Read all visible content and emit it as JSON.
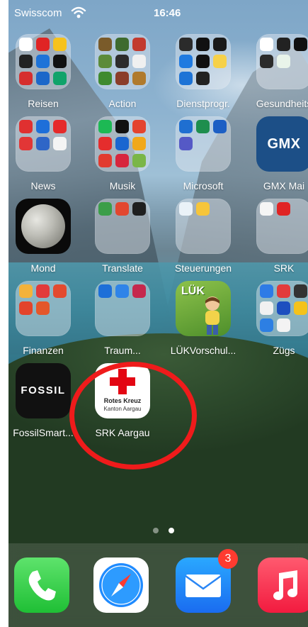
{
  "status_bar": {
    "carrier": "Swisscom",
    "time": "16:46"
  },
  "apps": [
    {
      "label": "Reisen"
    },
    {
      "label": "Action"
    },
    {
      "label": "Dienstprogr."
    },
    {
      "label": "Gesundheits"
    },
    {
      "label": "News"
    },
    {
      "label": "Musik"
    },
    {
      "label": "Microsoft"
    },
    {
      "label": "GMX Mai",
      "tile_text": "GMX"
    },
    {
      "label": "Mond"
    },
    {
      "label": "Translate"
    },
    {
      "label": "Steuerungen"
    },
    {
      "label": "SRK"
    },
    {
      "label": "Finanzen"
    },
    {
      "label": "Traum..."
    },
    {
      "label": "LÜKVorschul...",
      "tile_text": "LÜK"
    },
    {
      "label": "Zügs"
    },
    {
      "label": "FossilSmart...",
      "tile_text": "FOSSIL"
    },
    {
      "label": "SRK Aargau",
      "tile_line1": "Rotes Kreuz",
      "tile_line2": "Kanton Aargau"
    }
  ],
  "dock": {
    "apps": [
      {
        "name": "Phone"
      },
      {
        "name": "Safari"
      },
      {
        "name": "Mail",
        "badge": "3"
      },
      {
        "name": "Music"
      }
    ]
  },
  "page_indicator": {
    "total_pages": 2,
    "current_page": 2
  },
  "annotation": {
    "color": "#ef1b1b"
  }
}
